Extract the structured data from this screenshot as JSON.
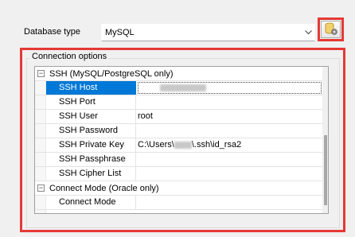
{
  "database": {
    "label": "Database type",
    "value": "MySQL"
  },
  "connection_options": {
    "title": "Connection options",
    "categories": [
      {
        "name": "SSH (MySQL/PostgreSQL only)",
        "toggle": "−",
        "properties": [
          {
            "name": "SSH Host",
            "value": "",
            "selected": true,
            "redacted": true
          },
          {
            "name": "SSH Port",
            "value": ""
          },
          {
            "name": "SSH User",
            "value": "root"
          },
          {
            "name": "SSH Password",
            "value": ""
          },
          {
            "name": "SSH Private Key",
            "value_prefix": "C:\\Users\\",
            "value_suffix": "\\.ssh\\id_rsa2",
            "redacted_middle": true
          },
          {
            "name": "SSH Passphrase",
            "value": ""
          },
          {
            "name": "SSH Cipher List",
            "value": ""
          }
        ]
      },
      {
        "name": "Connect Mode (Oracle only)",
        "toggle": "−",
        "properties": [
          {
            "name": "Connect Mode",
            "value": ""
          }
        ]
      }
    ]
  },
  "icons": {
    "dropdown": "chevron-down-icon",
    "db_settings": "database-settings-icon"
  },
  "colors": {
    "highlight_red": "#e53935",
    "selection_blue": "#0078d7"
  }
}
